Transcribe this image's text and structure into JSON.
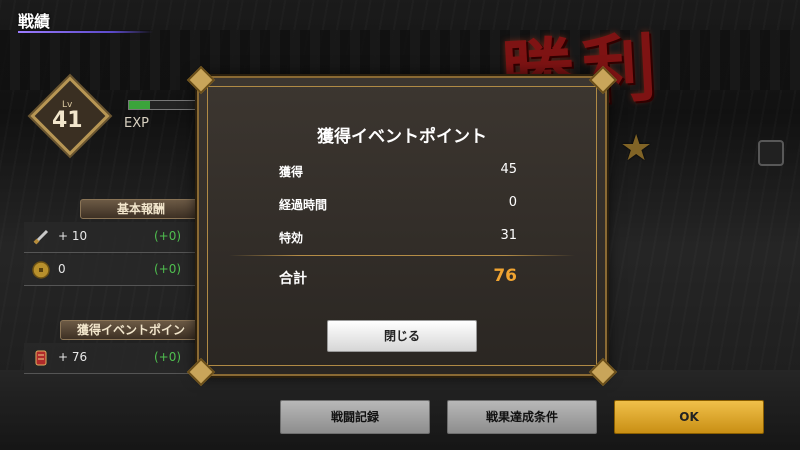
{
  "screen": {
    "title": "戦績"
  },
  "background": {
    "victory_text": "勝利"
  },
  "player": {
    "level_label": "Lv",
    "level": "41",
    "exp_label": "EXP",
    "exp_progress": 0.3
  },
  "basic_rewards": {
    "header": "基本報酬",
    "rows": [
      {
        "value": "+ 10",
        "delta": "(+0)",
        "icon": "sword-icon"
      },
      {
        "value": "0",
        "delta": "(+0)",
        "icon": "coin-icon"
      }
    ]
  },
  "event_rewards": {
    "header": "獲得イベントポイン",
    "rows": [
      {
        "value": "+ 76",
        "delta": "(+0)",
        "icon": "event-item-icon"
      }
    ]
  },
  "modal": {
    "title": "獲得イベントポイント",
    "rows": [
      {
        "label": "獲得",
        "value": "45"
      },
      {
        "label": "経過時間",
        "value": "0"
      },
      {
        "label": "特効",
        "value": "31"
      }
    ],
    "total_label": "合計",
    "total_value": "76",
    "close_label": "閉じる"
  },
  "footer": {
    "battle_log_label": "戦闘記録",
    "conditions_label": "戦果達成条件",
    "ok_label": "OK"
  },
  "colors": {
    "accent_gold": "#f0a431",
    "ok_button": "#e0aa2e",
    "delta_green": "#4fbf4f"
  }
}
